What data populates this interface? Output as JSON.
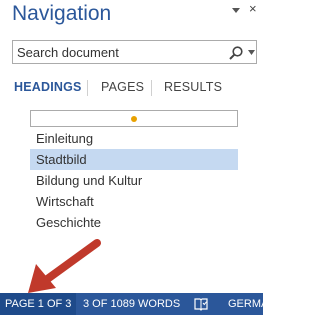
{
  "pane": {
    "title": "Navigation",
    "close_label": "×",
    "options_icon": "dropdown-triangle-icon"
  },
  "search": {
    "placeholder": "Search document",
    "icon": "magnifier-icon",
    "dropdown_icon": "chevron-down-icon"
  },
  "tabs": [
    {
      "label": "HEADINGS",
      "active": true
    },
    {
      "label": "PAGES",
      "active": false
    },
    {
      "label": "RESULTS",
      "active": false
    }
  ],
  "headings": [
    {
      "label": "Einleitung",
      "selected": false
    },
    {
      "label": "Stadtbild",
      "selected": true
    },
    {
      "label": "Bildung und Kultur",
      "selected": false
    },
    {
      "label": "Wirtschaft",
      "selected": false
    },
    {
      "label": "Geschichte",
      "selected": false
    }
  ],
  "status_bar": {
    "page": "PAGE 1 OF 3",
    "words": "3 OF 1089 WORDS",
    "proofing_icon": "proofing-book-icon",
    "language": "GERMA"
  },
  "colors": {
    "accent": "#2b579a",
    "selected_row": "#c5d9f1",
    "annotation_arrow": "#c0392b",
    "filter_marker": "#e8a100"
  }
}
